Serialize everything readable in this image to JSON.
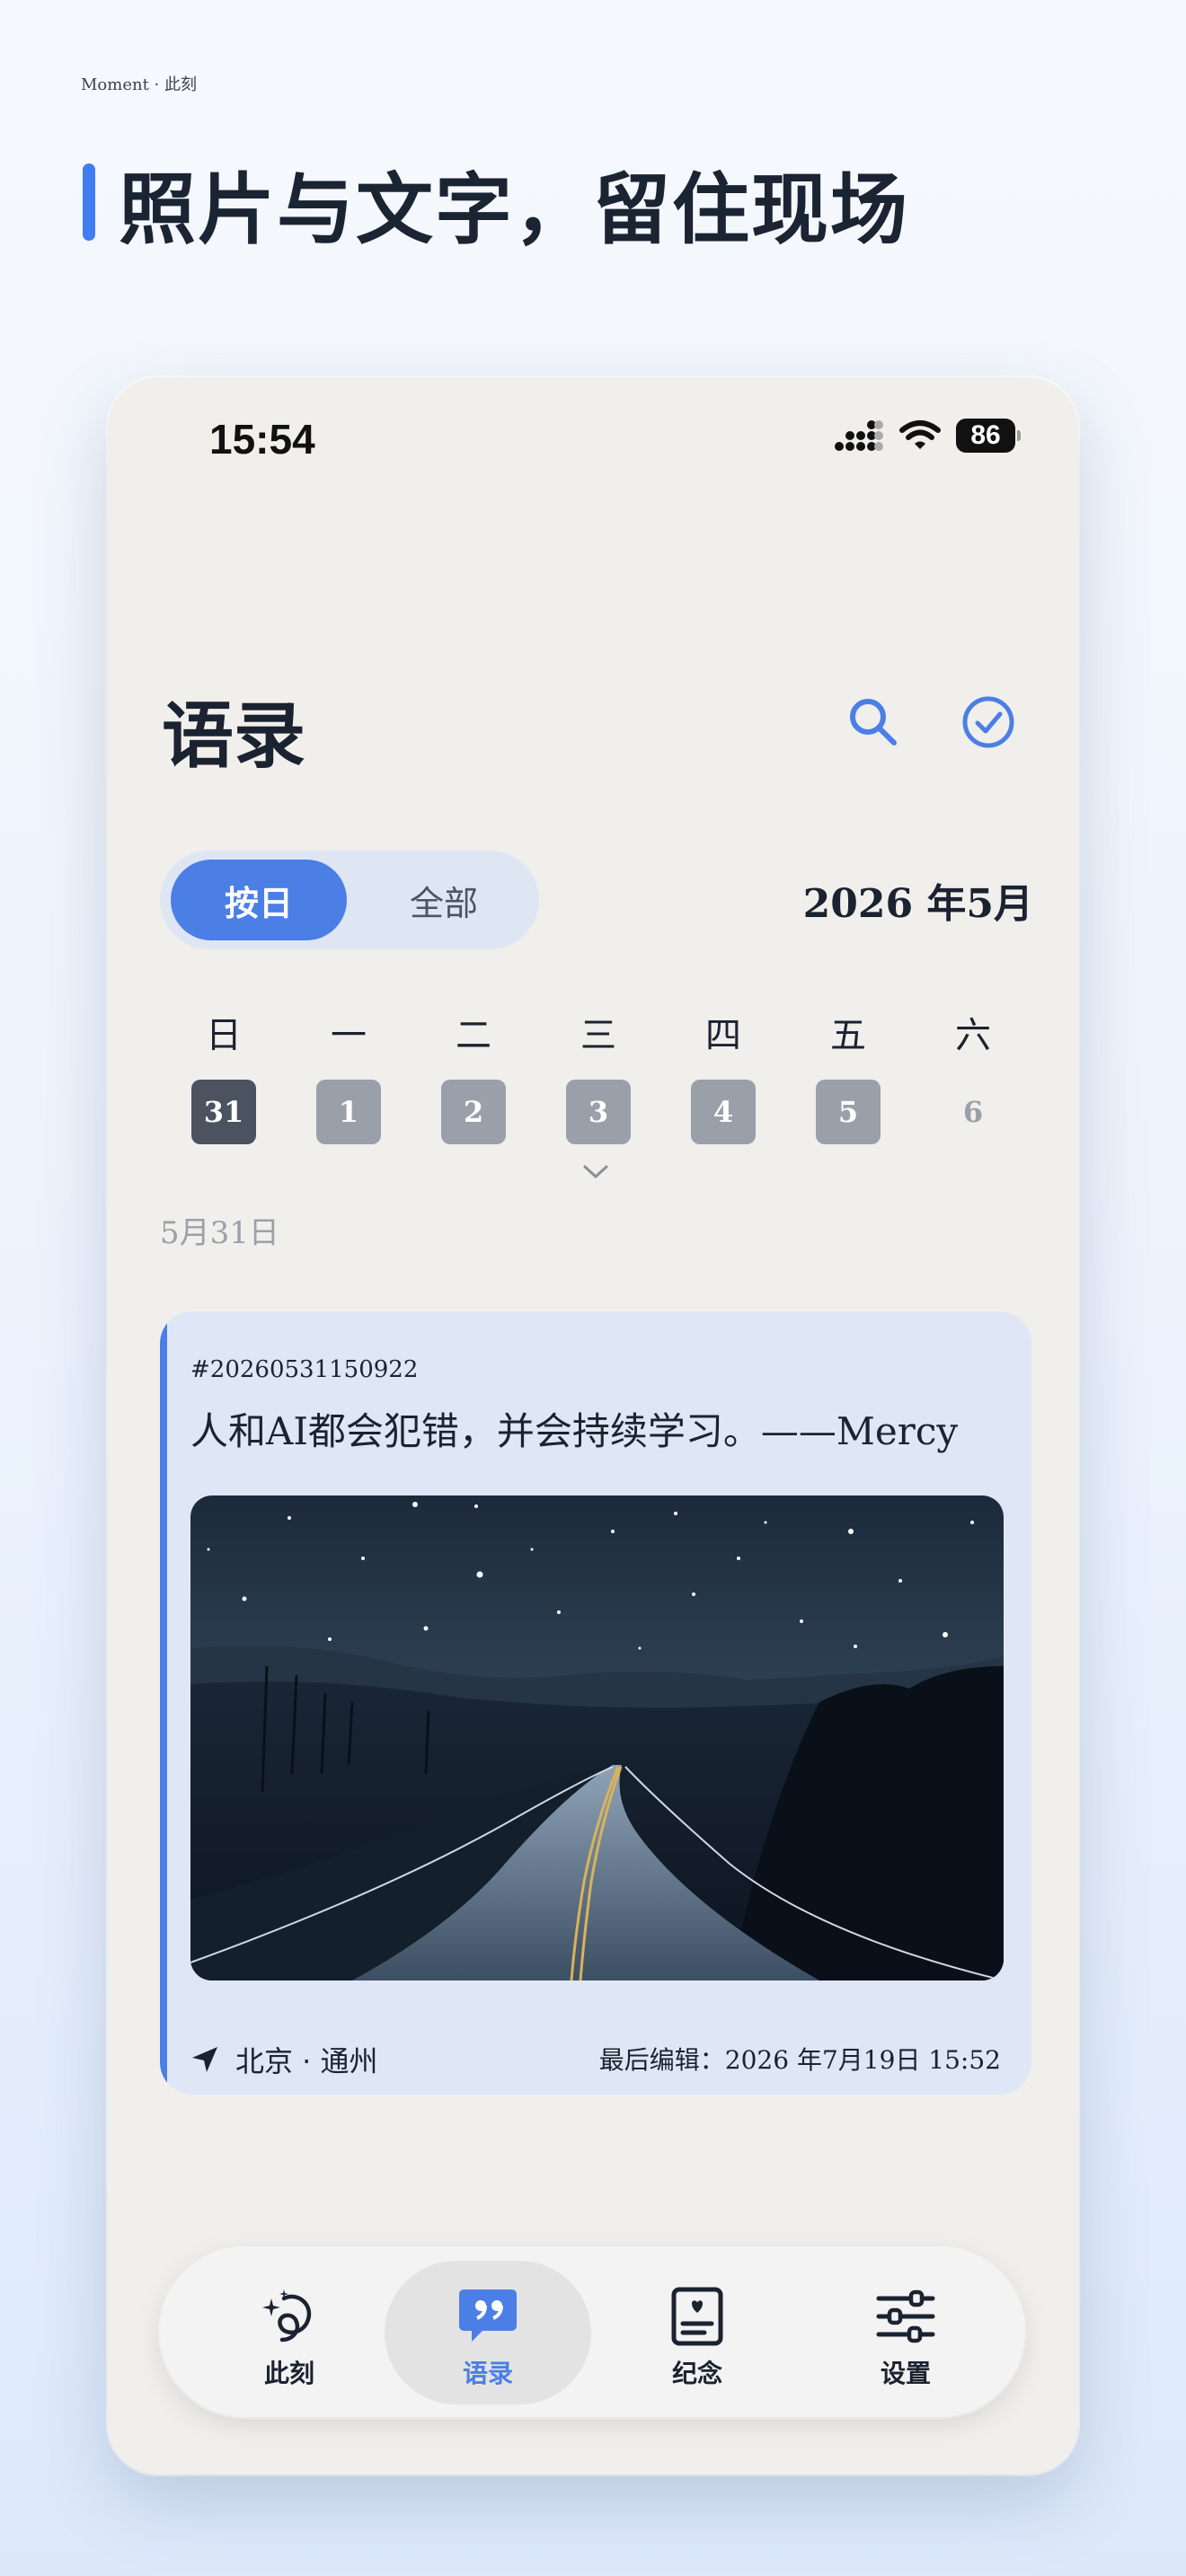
{
  "brand": "Moment · 此刻",
  "headline": "照片与文字，留住现场",
  "status": {
    "time": "15:54",
    "battery": "86"
  },
  "page_title": "语录",
  "segment": {
    "by_day": "按日",
    "all": "全部"
  },
  "month_label": "2026 年5月",
  "weekdays": [
    "日",
    "一",
    "二",
    "三",
    "四",
    "五",
    "六"
  ],
  "week_days": [
    {
      "num": "31",
      "state": "selected"
    },
    {
      "num": "1",
      "state": "has-entry"
    },
    {
      "num": "2",
      "state": "has-entry"
    },
    {
      "num": "3",
      "state": "has-entry"
    },
    {
      "num": "4",
      "state": "has-entry"
    },
    {
      "num": "5",
      "state": "has-entry"
    },
    {
      "num": "6",
      "state": "empty"
    }
  ],
  "date_label": "5月31日",
  "entry": {
    "id": "#20260531150922",
    "quote": "人和AI都会犯错，并会持续学习。——Mercy",
    "location": "北京 · 通州",
    "last_edited": "最后编辑：2026  年7月19日 15:52"
  },
  "tabs": [
    {
      "label": "此刻",
      "icon": "sparkle-loop-icon",
      "active": false
    },
    {
      "label": "语录",
      "icon": "quote-bubble-icon",
      "active": true
    },
    {
      "label": "纪念",
      "icon": "memo-card-icon",
      "active": false
    },
    {
      "label": "设置",
      "icon": "sliders-icon",
      "active": false
    }
  ],
  "colors": {
    "accent": "#4b7fe6",
    "phone_bg": "#f0efeb",
    "card_bg": "#dfe7f6"
  }
}
